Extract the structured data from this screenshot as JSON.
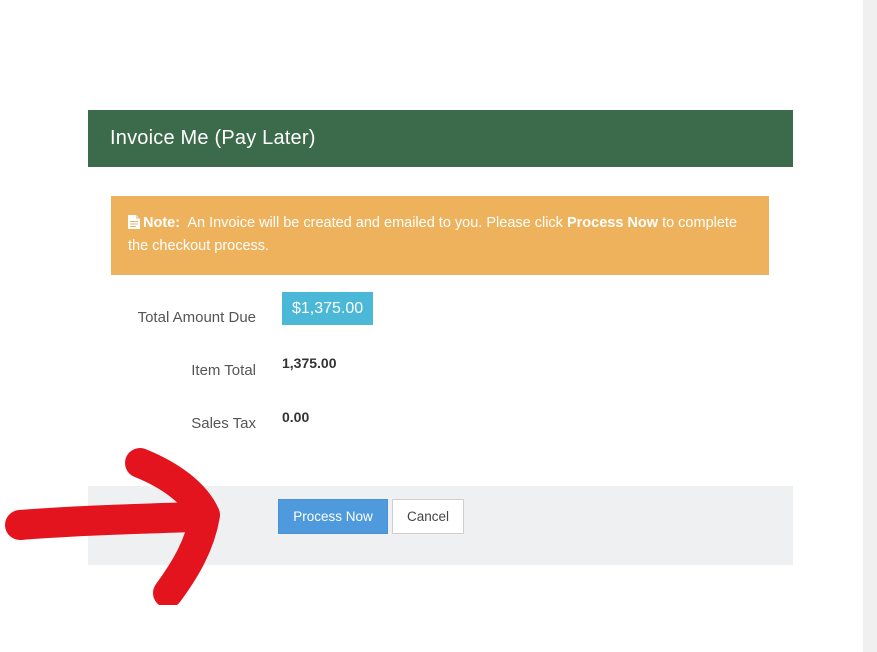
{
  "panel": {
    "title": "Invoice Me (Pay Later)"
  },
  "note": {
    "icon": "document-icon",
    "label": "Note:",
    "text_before": "An Invoice will be created and emailed to you. Please click",
    "emphasis": "Process Now",
    "text_after": "to complete the checkout process."
  },
  "summary": {
    "total_amount_due_label": "Total Amount Due",
    "total_amount_due_value": "$1,375.00",
    "item_total_label": "Item Total",
    "item_total_value": "1,375.00",
    "sales_tax_label": "Sales Tax",
    "sales_tax_value": "0.00"
  },
  "actions": {
    "process_now_label": "Process Now",
    "cancel_label": "Cancel"
  },
  "annotation": {
    "arrow_color": "#e3141e"
  },
  "colors": {
    "header_bg": "#3b6b4b",
    "note_bg": "#eeb25c",
    "badge_bg": "#4bb8d8",
    "primary_button": "#4f9adc"
  }
}
